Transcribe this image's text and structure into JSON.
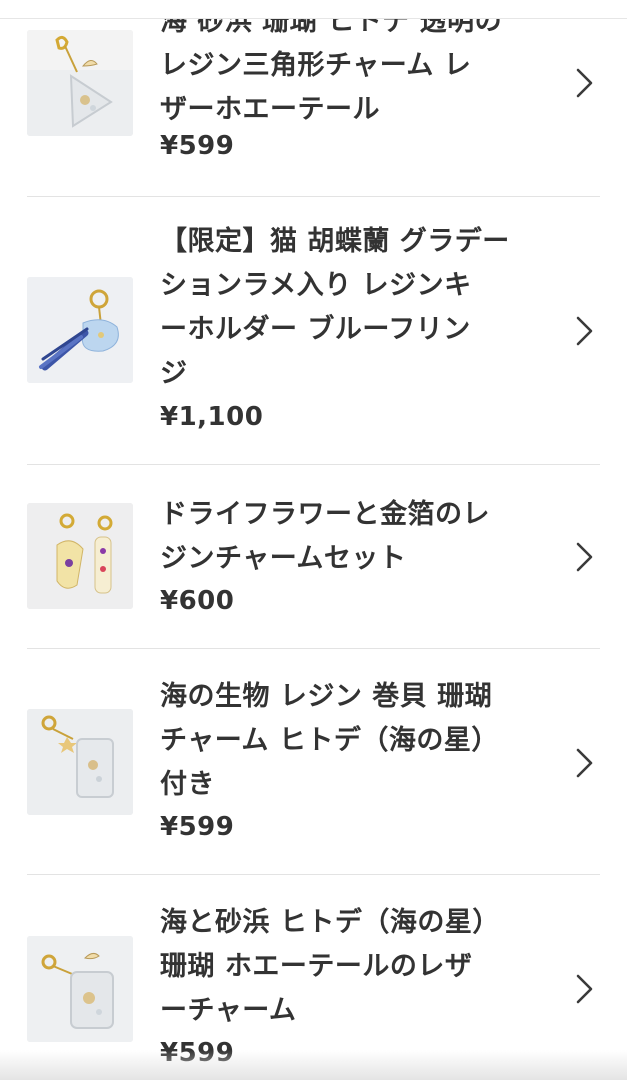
{
  "products": [
    {
      "title_lines": [
        "海 砂浜 珊瑚 ヒトデ 透明の",
        "レジン三角形チャーム レ",
        "ザーホエーテール"
      ],
      "price": "¥599",
      "thumbnail": "triangle-resin-charm-image"
    },
    {
      "title_lines": [
        "【限定】猫 胡蝶蘭 グラデー",
        "ションラメ入り レジンキ",
        "ーホルダー ブルーフリン",
        "ジ"
      ],
      "price": "¥1,100",
      "thumbnail": "blue-cat-keyholder-tassel-image"
    },
    {
      "title_lines": [
        "ドライフラワーと金箔のレ",
        "ジンチャームセット"
      ],
      "price": "¥600",
      "thumbnail": "dried-flower-charm-set-image"
    },
    {
      "title_lines": [
        "海の生物 レジン 巻貝 珊瑚",
        "チャーム ヒトデ（海の星）",
        "付き"
      ],
      "price": "¥599",
      "thumbnail": "sea-creature-resin-charm-image"
    },
    {
      "title_lines": [
        "海と砂浜 ヒトデ（海の星）",
        "珊瑚 ホエーテールのレザ",
        "ーチャーム"
      ],
      "price": "¥599",
      "thumbnail": "beach-whale-tail-charm-image"
    }
  ],
  "icons": {
    "row_action": "chevron-right-icon"
  }
}
